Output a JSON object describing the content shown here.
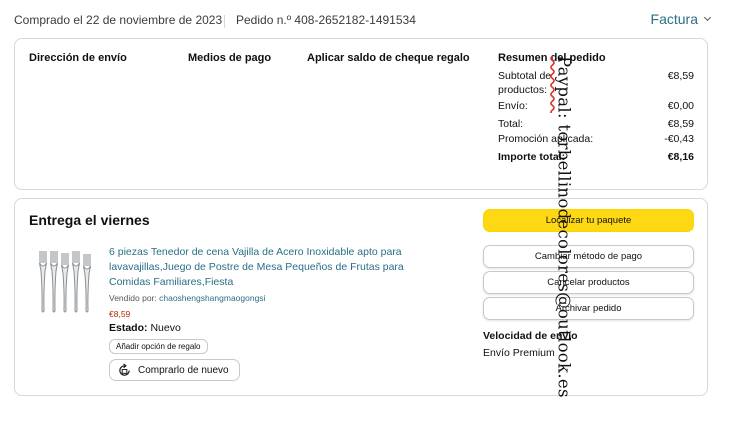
{
  "header": {
    "purchased": "Comprado el 22 de noviembre de 2023",
    "order": "Pedido n.º 408-2652182-1491534",
    "invoice": "Factura"
  },
  "summary_card": {
    "shipping_address": "Dirección de envío",
    "payment_methods": "Medios de pago",
    "gift_balance": "Aplicar saldo de cheque regalo",
    "order_summary": "Resumen del pedido",
    "rows": [
      {
        "label": "Subtotal de productos:",
        "value": "€8,59"
      },
      {
        "label": "Envío:",
        "value": "€0,00"
      },
      {
        "label": "Total:",
        "value": "€8,59"
      },
      {
        "label": "Promoción aplicada:",
        "value": "-€0,43"
      },
      {
        "label": "Importe total:",
        "value": "€8,16"
      }
    ]
  },
  "delivery_card": {
    "title": "Entrega el viernes",
    "product_title": "6 piezas Tenedor de cena Vajilla de Acero Inoxidable apto para lavavajillas,Juego de Postre de Mesa Pequeños de Frutas para Comidas Familiares,Fiesta",
    "sold_by_label": "Vendido por:",
    "seller": "chaoshengshangmaogongsi",
    "price": "€8,59",
    "state_label": "Estado:",
    "state_value": "Nuevo",
    "gift_option": "Añadir opción de regalo",
    "buy_again": "Comprarlo de nuevo",
    "actions": {
      "locate": "Localizar tu paquete",
      "change_payment": "Cambiar método de pago",
      "cancel": "Cancelar productos",
      "archive": "Archivar pedido"
    },
    "speed_label": "Velocidad de envío",
    "speed_value": "Envío Premium"
  },
  "watermark": {
    "prefix": "Paypal",
    "rest": ": torbellinodecolores@outlook.es"
  },
  "colors": {
    "link": "#2a6f86",
    "price": "#b12704",
    "primary_button": "#ffd814",
    "border": "#d5d9d9"
  },
  "icons": [
    "chevron-down-icon",
    "buy-again-icon",
    "forks-product-image"
  ]
}
